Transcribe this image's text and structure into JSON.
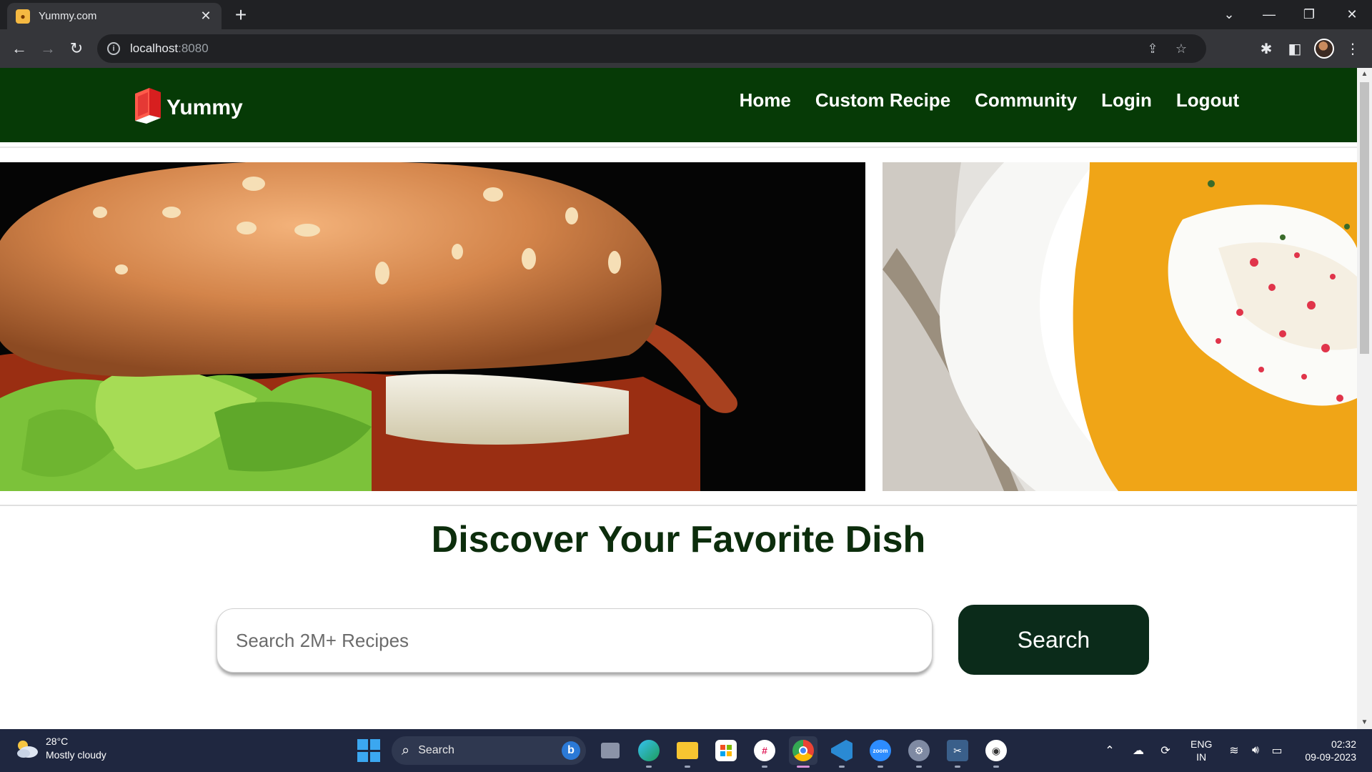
{
  "browser": {
    "tab_title": "Yummy.com",
    "url_host": "localhost",
    "url_port": ":8080",
    "colors": {
      "tabbar": "#202124",
      "toolbar": "#35363a"
    }
  },
  "site": {
    "logo_text": "Yummy",
    "nav": [
      "Home",
      "Custom Recipe",
      "Community",
      "Login",
      "Logout"
    ],
    "heading": "Discover Your Favorite Dish",
    "search_placeholder": "Search 2M+ Recipes",
    "search_button": "Search",
    "colors": {
      "nav_bg": "#063a06",
      "heading": "#0c2d0c",
      "button_bg": "#0b2b1a",
      "logo_red": "#e53935"
    }
  },
  "taskbar": {
    "weather_temp": "28°C",
    "weather_desc": "Mostly cloudy",
    "search_label": "Search",
    "lang_line1": "ENG",
    "lang_line2": "IN",
    "time": "02:32",
    "date": "09-09-2023"
  }
}
